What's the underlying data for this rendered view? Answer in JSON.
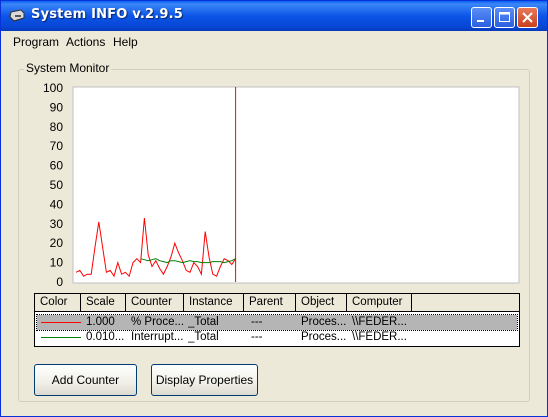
{
  "window": {
    "title": "System INFO v.2.9.5",
    "icon": "disk-drive-icon",
    "controls": [
      "minimize-icon",
      "maximize-icon",
      "close-icon"
    ]
  },
  "menu": {
    "items": [
      "Program",
      "Actions",
      "Help"
    ]
  },
  "monitor": {
    "group_title": "System Monitor",
    "y_ticks": [
      "100",
      "90",
      "80",
      "70",
      "60",
      "50",
      "40",
      "30",
      "20",
      "10",
      "0"
    ]
  },
  "chart_data": {
    "type": "line",
    "ylim": [
      0,
      100
    ],
    "grid": false,
    "x": [
      0,
      1,
      2,
      3,
      4,
      5,
      6,
      7,
      8,
      9,
      10,
      11,
      12,
      13,
      14,
      15,
      16,
      17,
      18,
      19,
      20,
      21,
      22,
      23,
      24,
      25,
      26,
      27,
      28,
      29,
      30,
      31,
      32,
      33,
      34,
      35,
      36,
      37,
      38,
      39,
      40,
      41,
      42
    ],
    "series": [
      {
        "color": "#ff0000",
        "values": [
          5,
          6,
          3,
          4,
          4,
          18,
          31,
          18,
          5,
          6,
          3,
          10,
          4,
          5,
          3,
          10,
          12,
          10,
          33,
          14,
          8,
          11,
          7,
          4,
          8,
          13,
          20,
          15,
          11,
          6,
          5,
          10,
          8,
          4,
          26,
          13,
          4,
          3,
          8,
          12,
          11,
          9,
          12
        ]
      },
      {
        "color": "#008000",
        "x_start": 17,
        "values": [
          12,
          11.5,
          11,
          11.5,
          12,
          11,
          10.5,
          10,
          11,
          11,
          10.5,
          10,
          10.5,
          11,
          10.5,
          10.5,
          10,
          10,
          10,
          10.5,
          10.5,
          10.5,
          10,
          10.5,
          11,
          12
        ]
      }
    ],
    "marker_x": 42
  },
  "counters": {
    "columns": [
      "Color",
      "Scale",
      "Counter",
      "Instance",
      "Parent",
      "Object",
      "Computer"
    ],
    "rows": [
      {
        "color": "#ff0000",
        "scale": "1.000",
        "counter": "% Proce...",
        "instance": "_Total",
        "parent": "---",
        "object": "Proces...",
        "computer": "\\\\FEDER..."
      },
      {
        "color": "#008000",
        "scale": "0.010...",
        "counter": "Interrupt...",
        "instance": "_Total",
        "parent": "---",
        "object": "Proces...",
        "computer": "\\\\FEDER..."
      }
    ]
  },
  "buttons": {
    "add_counter": "Add Counter",
    "display_properties": "Display Properties"
  }
}
